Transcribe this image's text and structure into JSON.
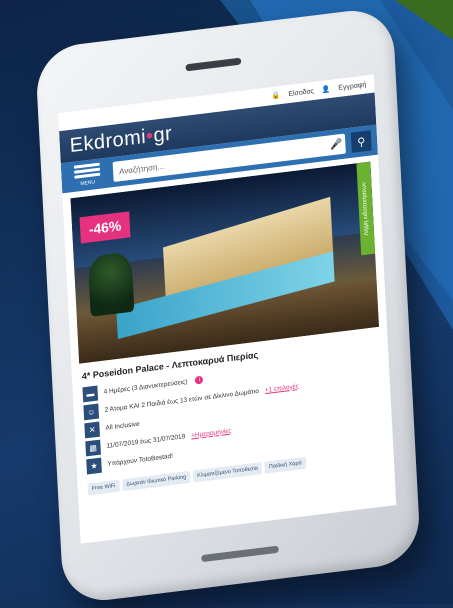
{
  "topbar": {
    "login": "Είσοδος",
    "register": "Εγγραφή"
  },
  "header": {
    "logo_text": "Ekdromi",
    "logo_suffix": "gr",
    "logo_dot": "•"
  },
  "searchrow": {
    "menu_label": "MENU",
    "search_placeholder": "Αναζήτηση..."
  },
  "hero": {
    "discount": "-46%",
    "side_tab": "Λήψη ειδοποιήσεων"
  },
  "offer": {
    "title": "4* Poseidon Palace - Λεπτοκαρυά Πιερίας",
    "rows": [
      {
        "icon": "bed-icon",
        "glyph": "▬",
        "text": "4 Ημέρες (3 Διανυκτερεύσεις)",
        "link": "",
        "info": "i"
      },
      {
        "icon": "people-icon",
        "glyph": "☺",
        "text": "2 Άτομα ΚΑΙ 2 Παιδιά έως 13 ετών σε Δίκλινο Δωμάτιο",
        "link": "+1 επιλογές",
        "info": ""
      },
      {
        "icon": "food-icon",
        "glyph": "✕",
        "text": "All Inclusive",
        "link": "",
        "info": ""
      },
      {
        "icon": "calendar-icon",
        "glyph": "▦",
        "text": "11/07/2019 έως 31/07/2019",
        "link": "+Ημερομηνίες",
        "info": ""
      },
      {
        "icon": "star-icon",
        "glyph": "★",
        "text": "Υπάρχουν TotoBestad!",
        "link": "",
        "info": ""
      }
    ],
    "tags": [
      "Free WiFi",
      "Δωρεάν Ιδιωτικό Parking",
      "Κλιματιζόμενο Τοποθεσία",
      "Παιδική Χαρά"
    ]
  },
  "colors": {
    "brand_blue": "#2d6fb0",
    "accent_pink": "#e6327e",
    "green_tab": "#6ab22f"
  }
}
